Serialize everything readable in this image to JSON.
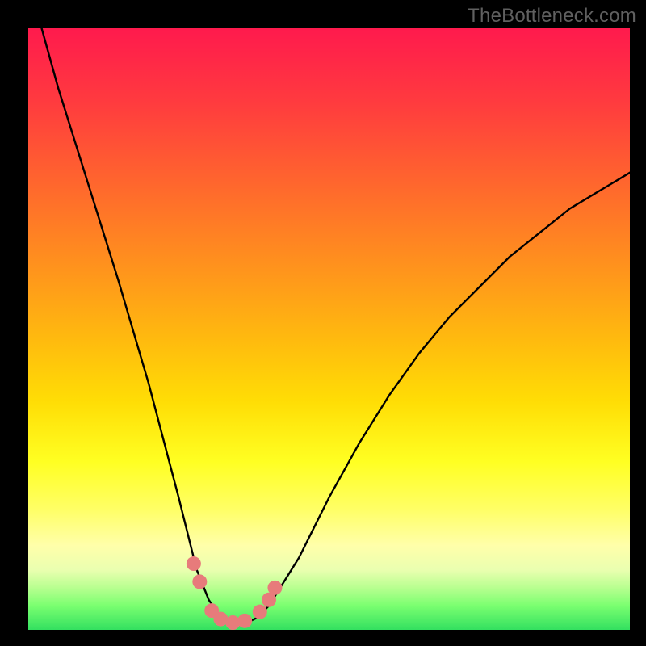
{
  "watermark": "TheBottleneck.com",
  "chart_data": {
    "type": "line",
    "title": "",
    "xlabel": "",
    "ylabel": "",
    "xlim": [
      0,
      100
    ],
    "ylim": [
      0,
      100
    ],
    "series": [
      {
        "name": "curve",
        "x": [
          0,
          5,
          10,
          15,
          20,
          25,
          28,
          30,
          32,
          34,
          36,
          38,
          40,
          45,
          50,
          55,
          60,
          65,
          70,
          75,
          80,
          85,
          90,
          95,
          100
        ],
        "values": [
          108,
          90,
          74,
          58,
          41,
          22,
          10,
          5,
          2,
          1,
          1,
          2,
          4,
          12,
          22,
          31,
          39,
          46,
          52,
          57,
          62,
          66,
          70,
          73,
          76
        ]
      }
    ],
    "markers": {
      "name": "highlight-dots",
      "color": "#e77b7b",
      "x": [
        27.5,
        28.5,
        30.5,
        32.0,
        34.0,
        36.0,
        38.5,
        40.0,
        41.0
      ],
      "values": [
        11.0,
        8.0,
        3.2,
        1.8,
        1.2,
        1.5,
        3.0,
        5.0,
        7.0
      ]
    },
    "gradient_stops": [
      {
        "pos": 0.0,
        "color": "#ff1a4d"
      },
      {
        "pos": 0.32,
        "color": "#ff7a26"
      },
      {
        "pos": 0.62,
        "color": "#ffdd05"
      },
      {
        "pos": 0.86,
        "color": "#ffffaa"
      },
      {
        "pos": 1.0,
        "color": "#33e060"
      }
    ]
  }
}
